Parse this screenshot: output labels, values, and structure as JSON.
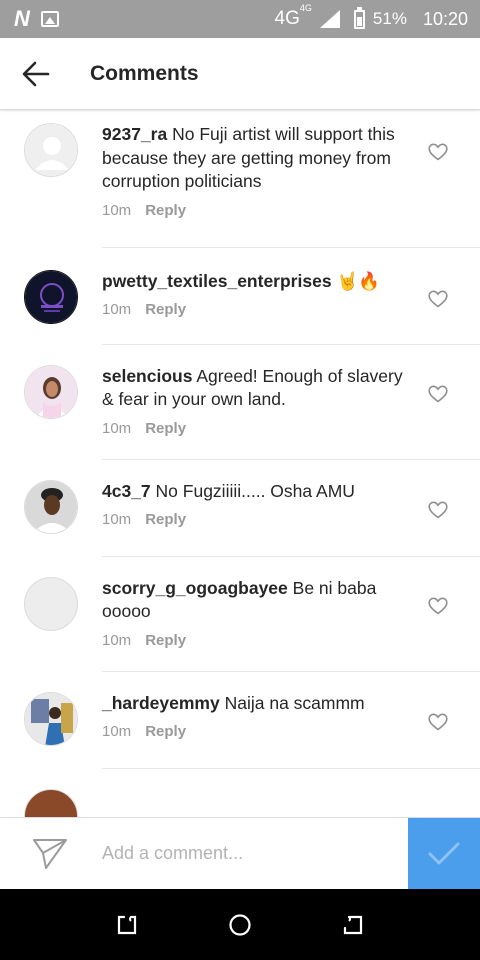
{
  "status_bar": {
    "network": "4G",
    "network_small": "4G",
    "battery": "51%",
    "time": "10:20"
  },
  "header": {
    "title": "Comments"
  },
  "comments": [
    {
      "username": "9237_ra",
      "text": "No Fuji artist will support this because they are getting money from corruption politicians",
      "time": "10m",
      "reply_label": "Reply",
      "avatar": "default"
    },
    {
      "username": "pwetty_textiles_enterprises",
      "text": "🤘🔥",
      "time": "10m",
      "reply_label": "Reply",
      "avatar": "dark-logo"
    },
    {
      "username": "selencious",
      "text": "Agreed! Enough of slavery & fear in your own land.",
      "time": "10m",
      "reply_label": "Reply",
      "avatar": "woman-photo"
    },
    {
      "username": "4c3_7",
      "text": "No Fugziiiii..... Osha AMU",
      "time": "10m",
      "reply_label": "Reply",
      "avatar": "man-photo"
    },
    {
      "username": "scorry_g_ogoagbayee",
      "text": "Be ni baba ooooo",
      "time": "10m",
      "reply_label": "Reply",
      "avatar": "blank"
    },
    {
      "username": "_hardeyemmy",
      "text": "Naija na scammm",
      "time": "10m",
      "reply_label": "Reply",
      "avatar": "group-photo"
    }
  ],
  "composer": {
    "placeholder": "Add a comment..."
  },
  "colors": {
    "status_bar": "#9e9e9e",
    "post_button": "#4a9eeb",
    "text": "#262626",
    "meta": "#999999"
  }
}
